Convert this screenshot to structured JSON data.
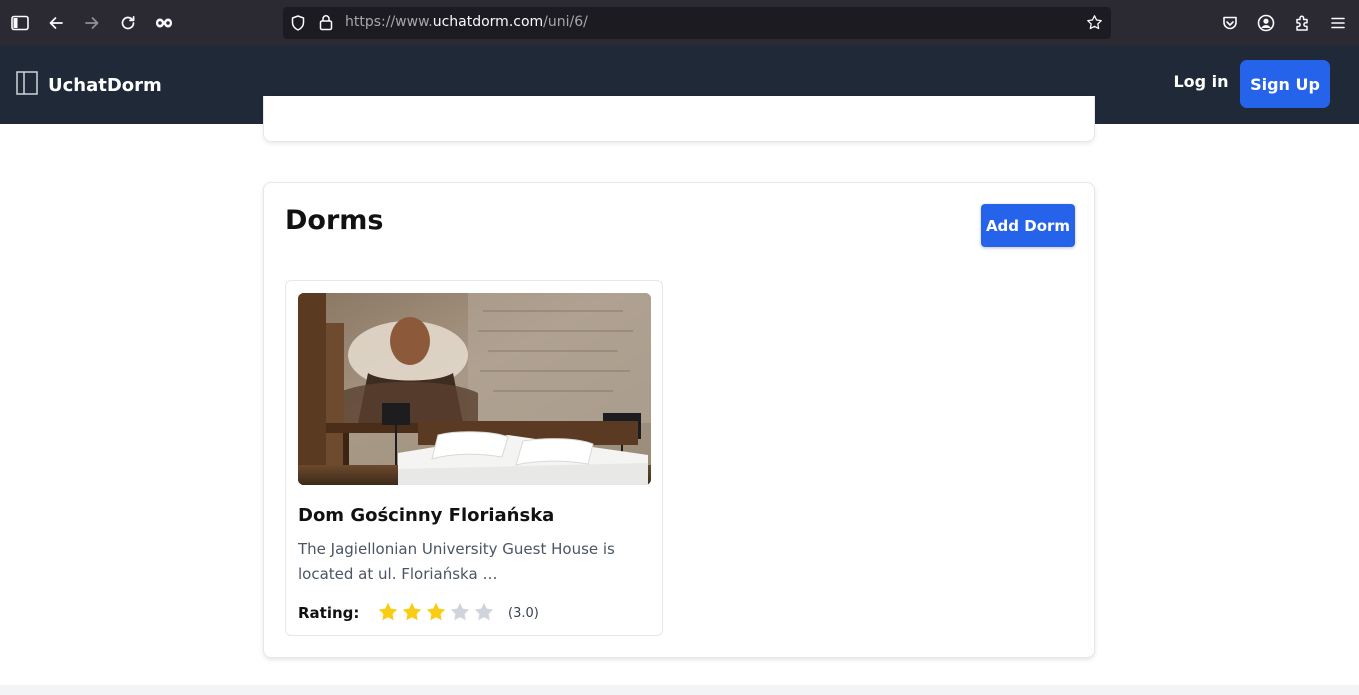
{
  "browser": {
    "url_prefix": "https://www.",
    "url_host": "uchatdorm.com",
    "url_path": "/uni/6/"
  },
  "nav": {
    "brand": "UchatDorm",
    "login_label": "Log in",
    "signup_label": "Sign Up"
  },
  "dorms": {
    "title": "Dorms",
    "add_button": "Add Dorm",
    "items": [
      {
        "name": "Dom Gościnny Floriańska",
        "description": "The Jagiellonian University Guest House is located at ul. Floriańska …",
        "rating_label": "Rating:",
        "rating": 3,
        "rating_max": 5,
        "rating_text": "(3.0)"
      }
    ]
  },
  "colors": {
    "nav_bg": "#1f2937",
    "accent": "#2563eb",
    "star_filled": "#facc15",
    "star_empty": "#d1d5db"
  }
}
